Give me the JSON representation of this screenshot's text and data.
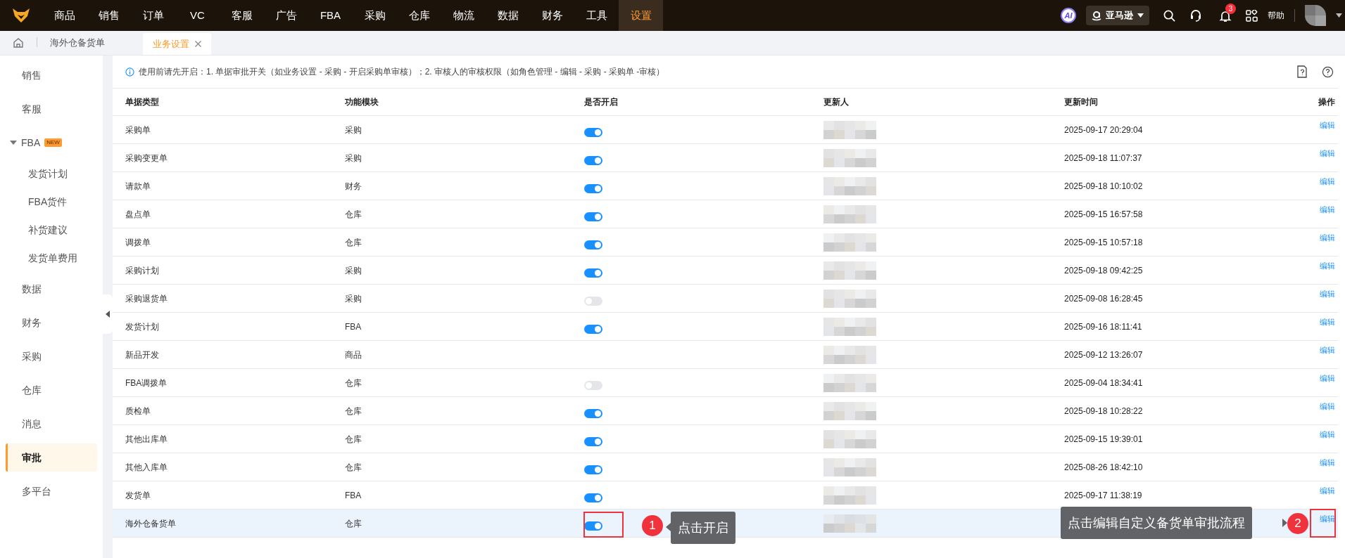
{
  "nav": {
    "items": [
      {
        "label": "商品",
        "selected": false
      },
      {
        "label": "销售",
        "selected": false
      },
      {
        "label": "订单",
        "selected": false
      },
      {
        "label": "VC",
        "selected": false
      },
      {
        "label": "客服",
        "selected": false
      },
      {
        "label": "广告",
        "selected": false
      },
      {
        "label": "FBA",
        "selected": false
      },
      {
        "label": "采购",
        "selected": false
      },
      {
        "label": "仓库",
        "selected": false
      },
      {
        "label": "物流",
        "selected": false
      },
      {
        "label": "数据",
        "selected": false
      },
      {
        "label": "财务",
        "selected": false
      },
      {
        "label": "工具",
        "selected": false
      },
      {
        "label": "设置",
        "selected": true
      }
    ]
  },
  "header_right": {
    "ai": "AI",
    "store": "亚马逊",
    "notifications": "3",
    "help": "帮助"
  },
  "tabs": [
    {
      "label": "海外仓备货单",
      "selected": false,
      "closable": false
    },
    {
      "label": "业务设置",
      "selected": true,
      "closable": true
    }
  ],
  "sidebar": {
    "items": [
      {
        "label": "销售",
        "selected": false
      },
      {
        "label": "客服",
        "selected": false
      },
      {
        "label": "FBA",
        "badge": "NEW",
        "expanded": true,
        "selected": false,
        "children": [
          {
            "label": "发货计划",
            "selected": false
          },
          {
            "label": "FBA货件",
            "selected": false
          },
          {
            "label": "补货建议",
            "selected": false
          },
          {
            "label": "发货单费用",
            "selected": false
          }
        ]
      },
      {
        "label": "数据",
        "selected": false
      },
      {
        "label": "财务",
        "selected": false
      },
      {
        "label": "采购",
        "selected": false
      },
      {
        "label": "仓库",
        "selected": false
      },
      {
        "label": "消息",
        "selected": false
      },
      {
        "label": "审批",
        "selected": true
      },
      {
        "label": "多平台",
        "selected": false
      }
    ]
  },
  "notice": "使用前请先开启：1. 单据审批开关（如业务设置 - 采购 - 开启采购单审核）；2. 审核人的审核权限（如角色管理 - 编辑 - 采购 - 采购单 -审核）",
  "table": {
    "columns": [
      "单据类型",
      "功能模块",
      "是否开启",
      "更新人",
      "更新时间",
      "操作"
    ],
    "rows": [
      {
        "type": "采购单",
        "module": "采购",
        "kind": "switch",
        "on": true,
        "updated": "2025-09-17 20:29:04",
        "action": "编辑",
        "selected": false
      },
      {
        "type": "采购变更单",
        "module": "采购",
        "kind": "switch",
        "on": true,
        "updated": "2025-09-18 11:07:37",
        "action": "编辑",
        "selected": false
      },
      {
        "type": "请款单",
        "module": "财务",
        "kind": "switch",
        "on": true,
        "updated": "2025-09-18 10:10:02",
        "action": "编辑",
        "selected": false
      },
      {
        "type": "盘点单",
        "module": "仓库",
        "kind": "switch",
        "on": true,
        "updated": "2025-09-15 16:57:58",
        "action": "编辑",
        "selected": false
      },
      {
        "type": "调拨单",
        "module": "仓库",
        "kind": "switch",
        "on": true,
        "updated": "2025-09-15 10:57:18",
        "action": "编辑",
        "selected": false
      },
      {
        "type": "采购计划",
        "module": "采购",
        "kind": "switch",
        "on": true,
        "updated": "2025-09-18 09:42:25",
        "action": "编辑",
        "selected": false
      },
      {
        "type": "采购退货单",
        "module": "采购",
        "kind": "switch",
        "on": false,
        "updated": "2025-09-08 16:28:45",
        "action": "编辑",
        "selected": false
      },
      {
        "type": "发货计划",
        "module": "FBA",
        "kind": "switch",
        "on": true,
        "updated": "2025-09-16 18:11:41",
        "action": "编辑",
        "selected": false
      },
      {
        "type": "新品开发",
        "module": "商品",
        "kind": "blank",
        "updated": "2025-09-12 13:26:07",
        "action": "编辑",
        "selected": false
      },
      {
        "type": "FBA调拨单",
        "module": "仓库",
        "kind": "switch",
        "on": false,
        "updated": "2025-09-04 18:34:41",
        "action": "编辑",
        "selected": false
      },
      {
        "type": "质检单",
        "module": "仓库",
        "kind": "switch",
        "on": true,
        "updated": "2025-09-18 10:28:22",
        "action": "编辑",
        "selected": false
      },
      {
        "type": "其他出库单",
        "module": "仓库",
        "kind": "switch",
        "on": true,
        "updated": "2025-09-15 19:39:01",
        "action": "编辑",
        "selected": false
      },
      {
        "type": "其他入库单",
        "module": "仓库",
        "kind": "switch",
        "on": true,
        "updated": "2025-08-26 18:42:10",
        "action": "编辑",
        "selected": false
      },
      {
        "type": "发货单",
        "module": "FBA",
        "kind": "switch",
        "on": true,
        "updated": "2025-09-17 11:38:19",
        "action": "编辑",
        "selected": false
      },
      {
        "type": "海外仓备货单",
        "module": "仓库",
        "kind": "switch",
        "on": true,
        "action": "编辑",
        "selected": true
      }
    ]
  },
  "callouts": [
    {
      "number": "1",
      "text": "点击开启"
    },
    {
      "number": "2",
      "text": "点击编辑自定义备货单审批流程"
    }
  ]
}
